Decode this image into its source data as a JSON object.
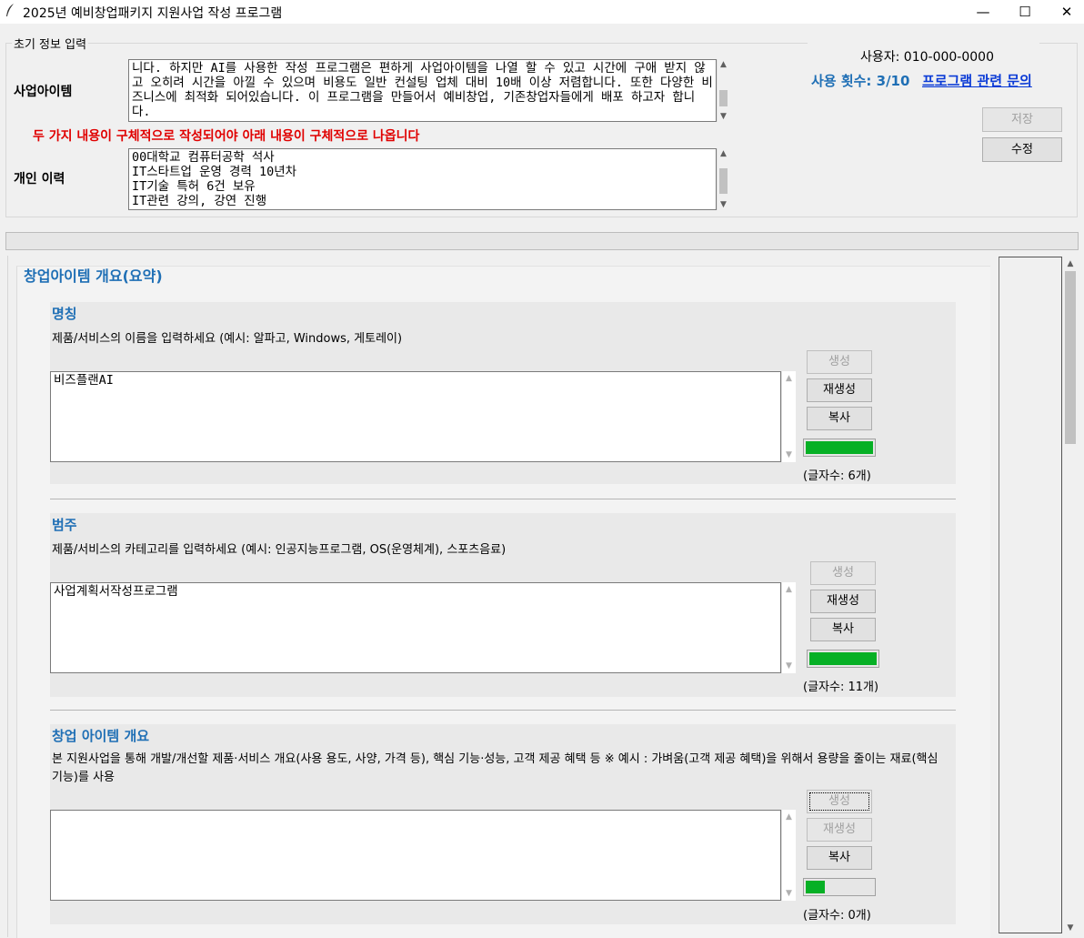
{
  "window": {
    "title": "2025년 예비창업패키지 지원사업 작성 프로그램",
    "minimize": "—",
    "maximize": "☐",
    "close": "✕"
  },
  "initial_info": {
    "legend": "초기 정보 입력",
    "business_item_label": "사업아이템",
    "business_item_text": "니다. 하지만 AI를 사용한 작성 프로그램은 편하게 사업아이템을 나열 할 수 있고 시간에 구애 받지 않고 오히려 시간을 아낄 수 있으며 비용도 일반 컨설팅 업체 대비 10배 이상 저렴합니다. 또한 다양한 비즈니스에 최적화 되어있습니다. 이 프로그램을 만들어서 예비창업, 기존창업자들에게 배포 하고자 합니다.",
    "warning": "두 가지 내용이 구체적으로 작성되어야 아래 내용이 구체적으로 나옵니다",
    "resume_label": "개인 이력",
    "resume_text": "00대학교 컴퓨터공학 석사\nIT스타트업 운영 경력 10년차\nIT기술 특허 6건 보유\nIT관련 강의, 강연 진행"
  },
  "account": {
    "user": "사용자: 010-000-0000",
    "usage": "사용 횟수: 3/10",
    "inquiry_link": "프로그램 관련 문의",
    "save_label": "저장",
    "edit_label": "수정"
  },
  "main": {
    "section_title": "창업아이템 개요(요약)",
    "cards": [
      {
        "title": "명칭",
        "desc": "제품/서비스의 이름을 입력하세요 (예시: 알파고, Windows, 게토레이)",
        "text": "비즈플랜AI",
        "generate": "생성",
        "regenerate": "재생성",
        "copy": "복사",
        "count": "(글자수: 6개)",
        "fill": 1.0
      },
      {
        "title": "범주",
        "desc": "제품/서비스의 카테고리를 입력하세요 (예시: 인공지능프로그램, OS(운영체계), 스포츠음료)",
        "text": "사업계획서작성프로그램",
        "generate": "생성",
        "regenerate": "재생성",
        "copy": "복사",
        "count": "(글자수: 11개)",
        "fill": 1.0
      },
      {
        "title": "창업 아이템 개요",
        "desc": "본 지원사업을 통해 개발/개선할 제품·서비스 개요(사용 용도, 사양, 가격 등), 핵심 기능·성능, 고객 제공 혜택 등 ※ 예시 : 가벼움(고객 제공 혜택)을 위해서 용량을 줄이는 재료(핵심 기능)를 사용",
        "text": "",
        "generate": "생성",
        "regenerate": "재생성",
        "copy": "복사",
        "count": "(글자수: 0개)",
        "fill": 0.28
      }
    ]
  },
  "icons": {
    "app": "feather-icon",
    "up": "▲",
    "down": "▼"
  }
}
